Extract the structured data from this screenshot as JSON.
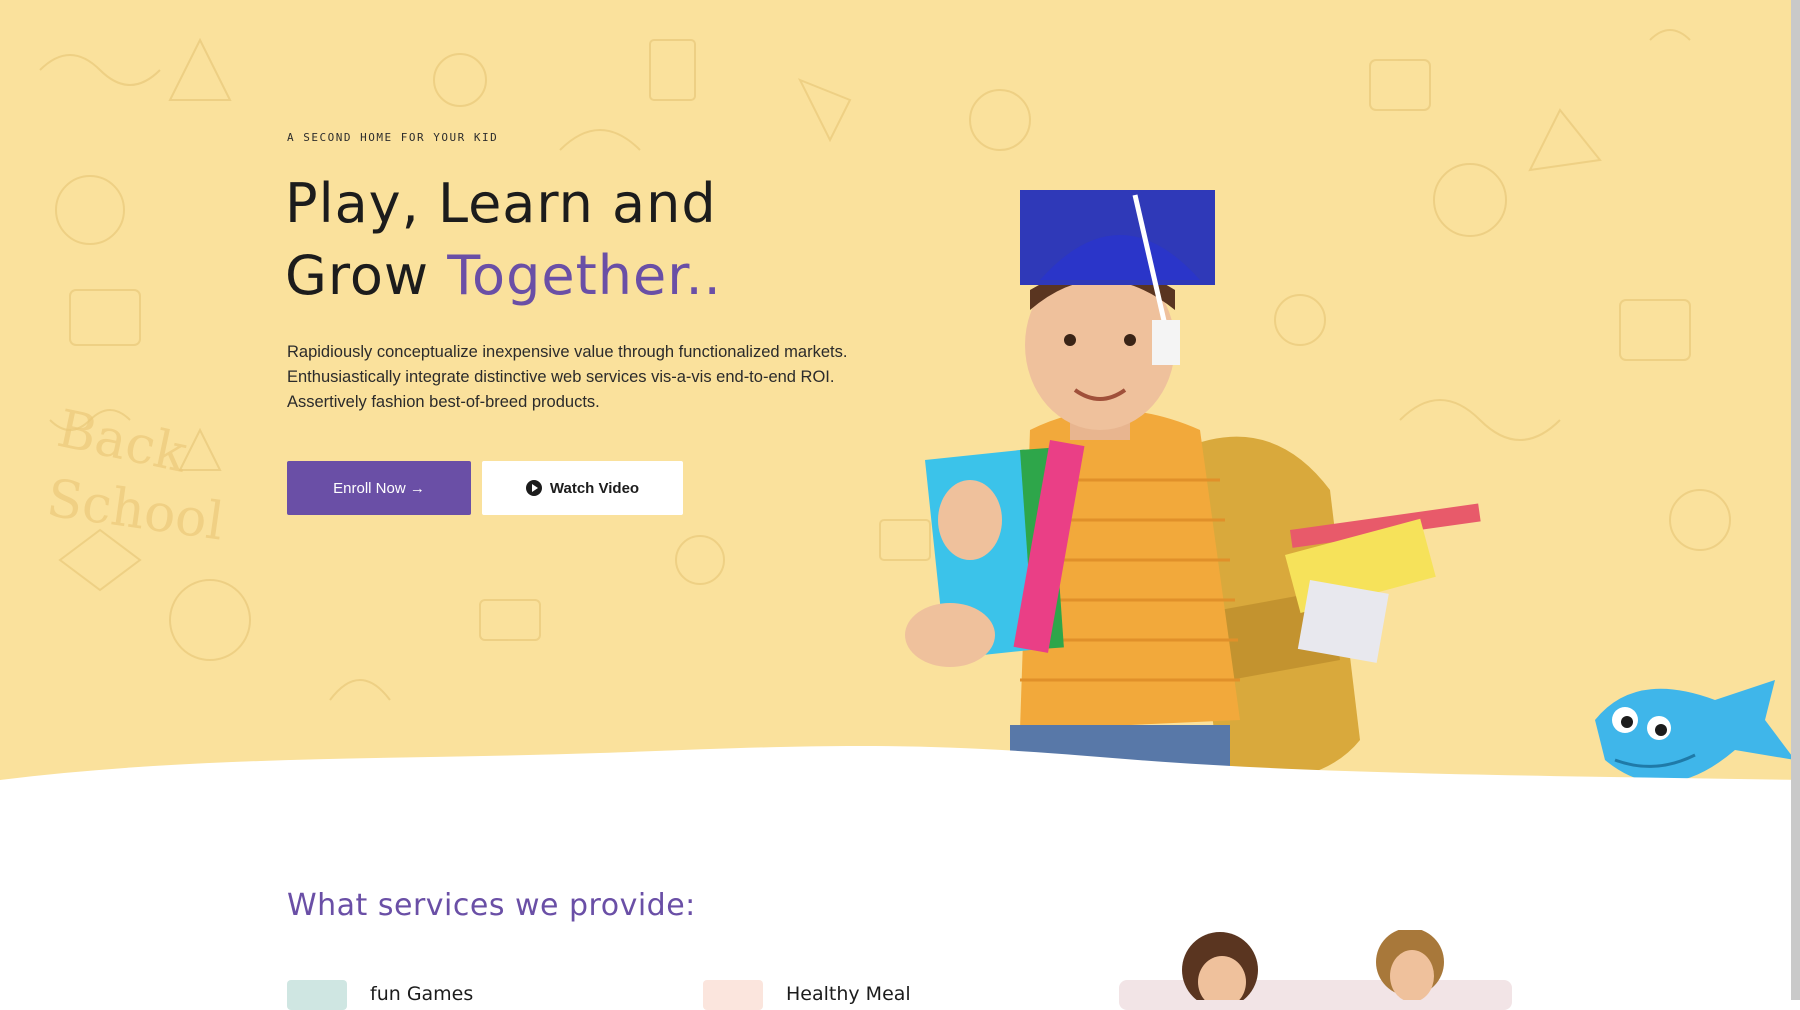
{
  "hero": {
    "tagline": "A SECOND HOME FOR YOUR KID",
    "headline_line1": "Play, Learn and",
    "headline_line2_plain": "Grow ",
    "headline_line2_accent": "Together..",
    "intro_line1": "Rapidiously conceptualize inexpensive value through functionalized markets.",
    "intro_line2": "Enthusiastically integrate distinctive web services vis-a-vis end-to-end ROI.",
    "intro_line3": "Assertively fashion best-of-breed products.",
    "enroll_label": "Enroll Now →",
    "watch_label": "Watch Video"
  },
  "services": {
    "title": "What services we provide:",
    "items": [
      {
        "label": "fun Games",
        "icon": "puzzle-icon"
      },
      {
        "label": "Healthy Meal",
        "icon": "meal-icon"
      }
    ]
  },
  "colors": {
    "hero_bg": "#fae19c",
    "accent": "#6a4fa6",
    "text": "#1c1c1c"
  }
}
